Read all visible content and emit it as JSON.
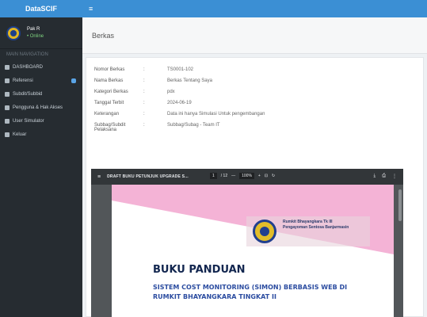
{
  "app": {
    "brand": "DataSCIF"
  },
  "user": {
    "name": "Pak R",
    "status": "• Online"
  },
  "sidebar": {
    "header": "MAIN NAVIGATION",
    "items": [
      {
        "label": "DASHBOARD",
        "icon": "dashboard-icon"
      },
      {
        "label": "Referensi",
        "icon": "list-icon",
        "badge": true
      },
      {
        "label": "Subdit/Subbid",
        "icon": "building-icon"
      },
      {
        "label": "Pengguna & Hak Akses",
        "icon": "users-icon"
      },
      {
        "label": "User Simulator",
        "icon": "person-icon"
      },
      {
        "label": "Keluar",
        "icon": "logout-icon"
      }
    ]
  },
  "topbar": {
    "toggle": "≡"
  },
  "page": {
    "title": "Berkas"
  },
  "detail": {
    "rows": [
      {
        "label": "Nomor Berkas",
        "sep": ":",
        "value": "TS0001-102"
      },
      {
        "label": "Nama Berkas",
        "sep": ":",
        "value": "Berkas Tentang Saya"
      },
      {
        "label": "Kategori Berkas",
        "sep": ":",
        "value": "pdx"
      },
      {
        "label": "Tanggal Terbit",
        "sep": ":",
        "value": "2024-06-19"
      },
      {
        "label": "Keterangan",
        "sep": ":",
        "value": "Data ini hanya Simulasi Untuk pengembangan"
      },
      {
        "label": "Subbag/Subdit Pelaksana",
        "sep": ":",
        "value": "Subbag/Subag - Team IT"
      }
    ]
  },
  "pdf": {
    "menu": "≡",
    "title": "DRAFT BUKU PETUNJUK UPGRADE S...",
    "page": "1",
    "pages": "/ 12",
    "zoom_out": "—",
    "zoom": "100%",
    "zoom_in": "+",
    "fit": "⊡",
    "rotate": "↻",
    "download": "⤓",
    "print": "⎙",
    "more": "⋮",
    "org": "Rumkit Bhayangkara Tk III Pengayoman Sentosa Banjarmasin",
    "book_title": "BUKU PANDUAN",
    "book_sub": "SISTEM COST MONITORING (SIMON) BERBASIS WEB DI RUMKIT BHAYANGKARA TINGKAT II"
  },
  "colors": {
    "accent": "#3b8fd4",
    "sidebar": "#262c31",
    "pink": "#f4b3d6"
  }
}
